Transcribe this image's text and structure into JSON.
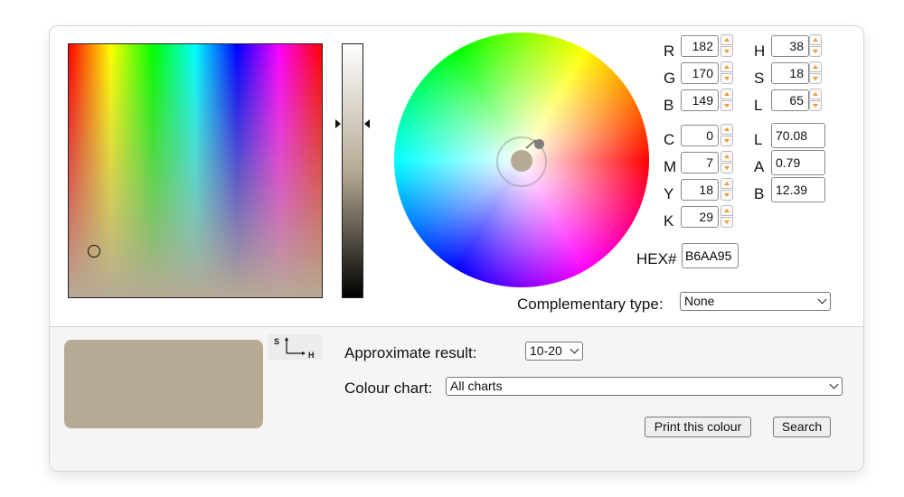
{
  "rgb": {
    "r_label": "R",
    "r_value": "182",
    "g_label": "G",
    "g_value": "170",
    "b_label": "B",
    "b_value": "149"
  },
  "hsl": {
    "h_label": "H",
    "h_value": "38",
    "s_label": "S",
    "s_value": "18",
    "l_label": "L",
    "l_value": "65"
  },
  "cmyk": {
    "c_label": "C",
    "c_value": "0",
    "m_label": "M",
    "m_value": "7",
    "y_label": "Y",
    "y_value": "18",
    "k_label": "K",
    "k_value": "29"
  },
  "lab": {
    "l_label": "L",
    "l_value": "70.08",
    "a_label": "A",
    "a_value": "0.79",
    "b_label": "B",
    "b_value": "12.39"
  },
  "hex": {
    "label": "HEX#",
    "value": "B6AA95"
  },
  "complementary": {
    "label": "Complementary type:",
    "selected": "None"
  },
  "axis_icon": {
    "s_label": "S",
    "h_label": "H"
  },
  "approx": {
    "label": "Approximate result:",
    "selected": "10-20"
  },
  "chart": {
    "label": "Colour chart:",
    "selected": "All charts"
  },
  "buttons": {
    "print": "Print this colour",
    "search": "Search"
  },
  "colors": {
    "current": "#b6aa95",
    "accent": "#f39a2c"
  },
  "icons": [
    "spin-up-icon",
    "spin-down-icon",
    "chevron-down-icon",
    "axis-icon"
  ]
}
